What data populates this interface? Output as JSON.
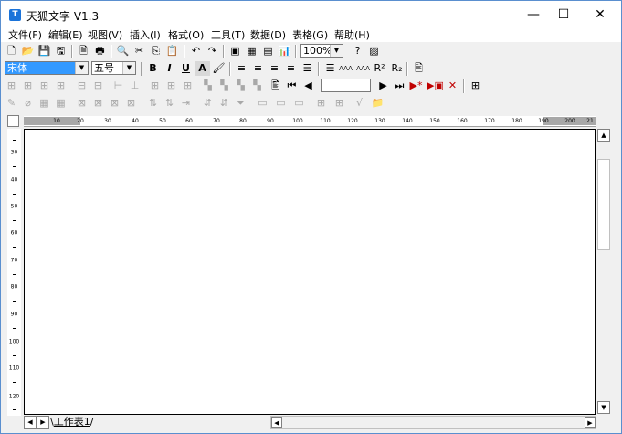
{
  "window": {
    "title": "天狐文字 V1.3",
    "minimize": "—",
    "maximize": "☐",
    "close": "✕"
  },
  "menu": [
    "文件(F)",
    "编辑(E)",
    "视图(V)",
    "插入(I)",
    "格式(O)",
    "工具(T)",
    "数据(D)",
    "表格(G)",
    "帮助(H)"
  ],
  "toolbar1": {
    "zoom": "100%"
  },
  "toolbar2": {
    "font": "宋体",
    "size": "五号",
    "bold": "B",
    "italic": "I",
    "underline": "U",
    "font_color": "A",
    "superscript": "R²",
    "subscript": "R₂",
    "shrink_font": "AAA",
    "grow_font": "AAA"
  },
  "ruler_h": [
    "10",
    "20",
    "30",
    "40",
    "50",
    "60",
    "70",
    "80",
    "90",
    "100",
    "110",
    "120",
    "130",
    "140",
    "150",
    "160",
    "170",
    "180",
    "190",
    "200",
    "21"
  ],
  "ruler_v": [
    "30",
    "40",
    "50",
    "60",
    "70",
    "80",
    "90",
    "100",
    "110",
    "120"
  ],
  "sheet_tab": "工作表1"
}
